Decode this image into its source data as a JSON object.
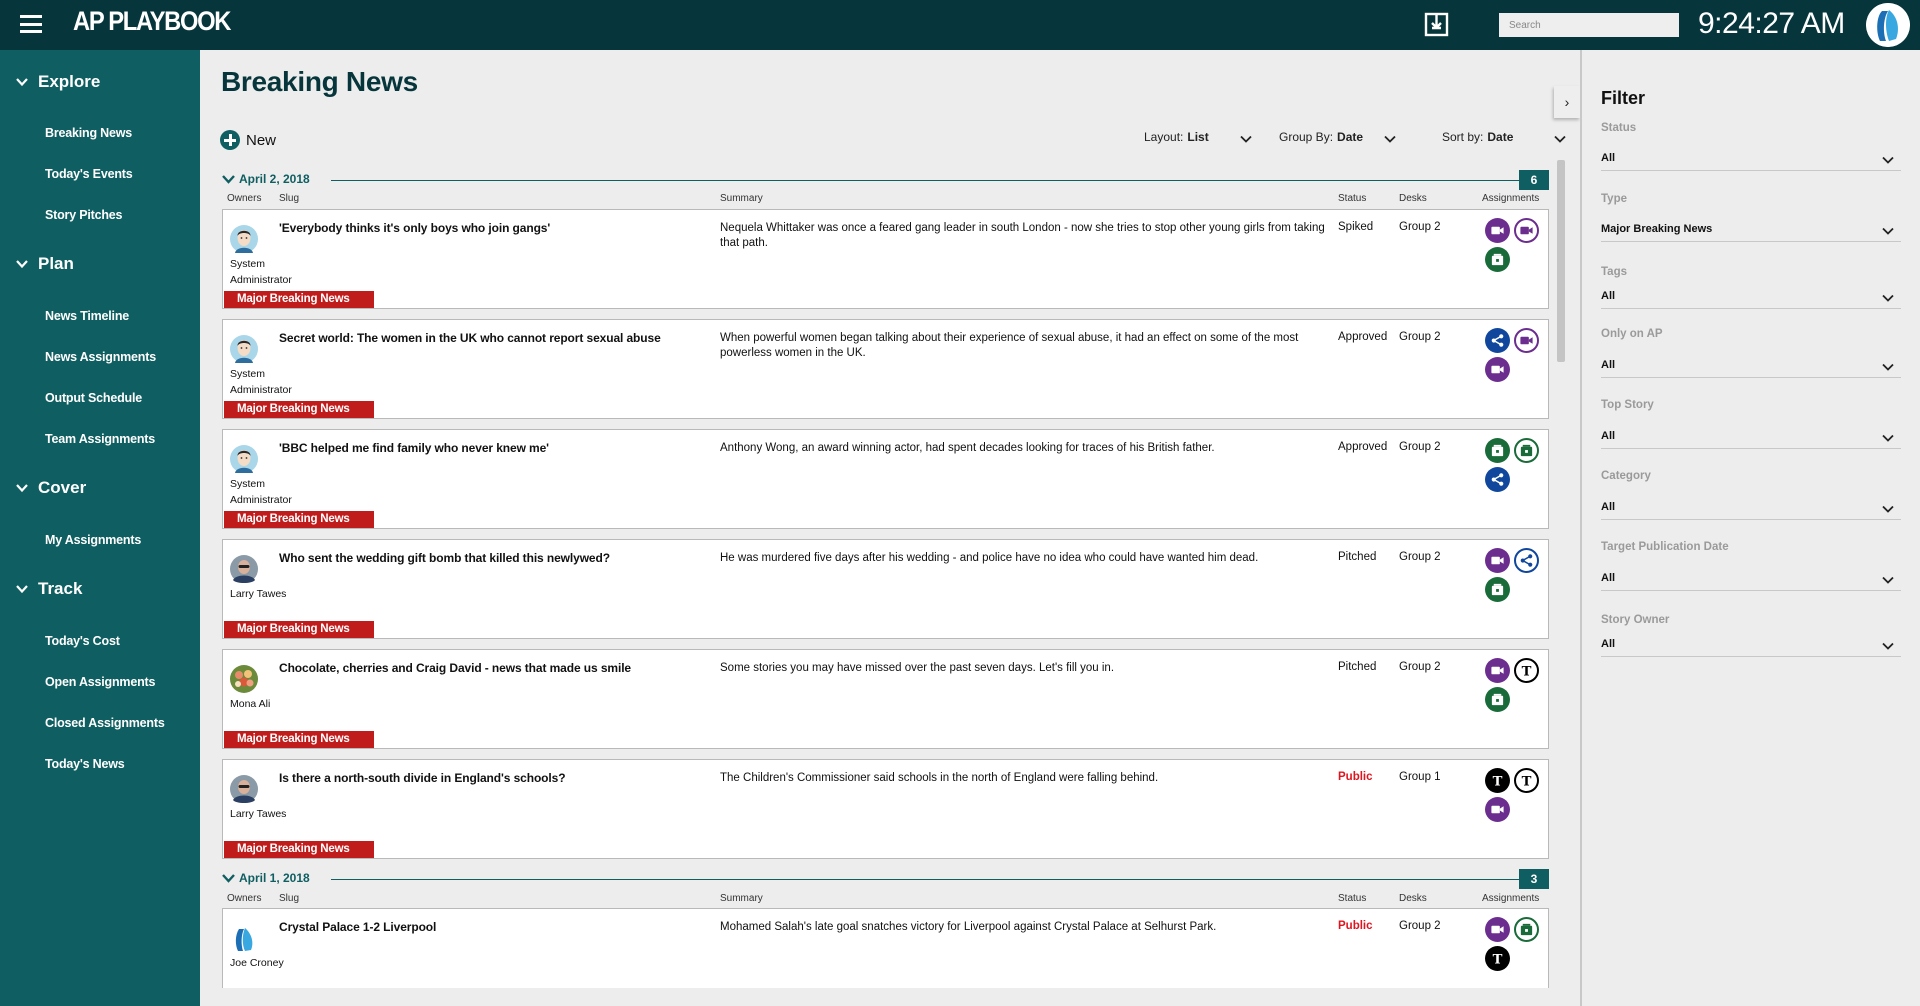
{
  "app": {
    "logo": "AP PLAYBOOK",
    "clock": "9:24:27 AM",
    "search_placeholder": "Search"
  },
  "sidebar": {
    "sections": [
      {
        "label": "Explore",
        "items": [
          "Breaking News",
          "Today's Events",
          "Story Pitches"
        ]
      },
      {
        "label": "Plan",
        "items": [
          "News Timeline",
          "News Assignments",
          "Output Schedule",
          "Team Assignments"
        ]
      },
      {
        "label": "Cover",
        "items": [
          "My Assignments"
        ]
      },
      {
        "label": "Track",
        "items": [
          "Today's Cost",
          "Open Assignments",
          "Closed Assignments",
          "Today's News"
        ]
      }
    ]
  },
  "main": {
    "title": "Breaking News",
    "new_label": "New",
    "layout": {
      "label": "Layout:",
      "value": "List"
    },
    "group_by": {
      "label": "Group By:",
      "value": "Date"
    },
    "sort_by": {
      "label": "Sort by:",
      "value": "Date"
    },
    "columns": {
      "owners": "Owners",
      "slug": "Slug",
      "summary": "Summary",
      "status": "Status",
      "desks": "Desks",
      "assignments": "Assignments"
    },
    "groups": [
      {
        "date": "April 2, 2018",
        "count": "6",
        "stories": [
          {
            "owner": "System Administrator",
            "avatar": "admin",
            "slug": "'Everybody thinks it's only boys who join gangs'",
            "summary": "Nequela Whittaker was once a feared gang leader in south London - now she tries to stop other young girls from taking that path.",
            "status": "Spiked",
            "desk": "Group 2",
            "type": "Major Breaking News",
            "assignments": [
              {
                "kind": "video",
                "style": "filled"
              },
              {
                "kind": "video",
                "style": "outline"
              },
              {
                "kind": "photo",
                "style": "filled"
              }
            ]
          },
          {
            "owner": "System Administrator",
            "avatar": "admin",
            "slug": "Secret world: The women in the UK who cannot report sexual abuse",
            "summary": "When powerful women began talking about their experience of sexual abuse, it had an effect on some of the most powerless women in the UK.",
            "status": "Approved",
            "desk": "Group 2",
            "type": "Major Breaking News",
            "assignments": [
              {
                "kind": "social",
                "style": "filled"
              },
              {
                "kind": "video",
                "style": "outline"
              },
              {
                "kind": "video",
                "style": "filled"
              }
            ]
          },
          {
            "owner": "System Administrator",
            "avatar": "admin",
            "slug": "'BBC helped me find family who never knew me'",
            "summary": "Anthony Wong, an award winning actor, had spent decades looking for traces of his British father.",
            "status": "Approved",
            "desk": "Group 2",
            "type": "Major Breaking News",
            "assignments": [
              {
                "kind": "photo",
                "style": "filled"
              },
              {
                "kind": "photo",
                "style": "outline"
              },
              {
                "kind": "social",
                "style": "filled"
              }
            ]
          },
          {
            "owner": "Larry Tawes",
            "avatar": "larry",
            "slug": "Who sent the wedding gift bomb that killed this newlywed?",
            "summary": "He was murdered five days after his wedding - and police have no idea who could have wanted him dead.",
            "status": "Pitched",
            "desk": "Group 2",
            "type": "Major Breaking News",
            "assignments": [
              {
                "kind": "video",
                "style": "filled"
              },
              {
                "kind": "social",
                "style": "outline"
              },
              {
                "kind": "photo",
                "style": "filled"
              }
            ]
          },
          {
            "owner": "Mona Ali",
            "avatar": "mona",
            "slug": "Chocolate, cherries and Craig David - news that made us smile",
            "summary": "Some stories you may have missed over the past seven days. Let's fill you in.",
            "status": "Pitched",
            "desk": "Group 2",
            "type": "Major Breaking News",
            "assignments": [
              {
                "kind": "video",
                "style": "filled"
              },
              {
                "kind": "text",
                "style": "outline"
              },
              {
                "kind": "photo",
                "style": "filled"
              }
            ]
          },
          {
            "owner": "Larry Tawes",
            "avatar": "larry",
            "slug": "Is there a north-south divide in England's schools?",
            "summary": "The Children's Commissioner said schools in the north of England were falling behind.",
            "status": "Public",
            "desk": "Group 1",
            "type": "Major Breaking News",
            "assignments": [
              {
                "kind": "text",
                "style": "filled"
              },
              {
                "kind": "text",
                "style": "outline"
              },
              {
                "kind": "video",
                "style": "filled"
              }
            ]
          }
        ]
      },
      {
        "date": "April 1, 2018",
        "count": "3",
        "stories": [
          {
            "owner": "Joe Croney",
            "avatar": "ap",
            "slug": "Crystal Palace 1-2 Liverpool",
            "summary": "Mohamed Salah's late goal snatches victory for Liverpool against Crystal Palace at Selhurst Park.",
            "status": "Public",
            "desk": "Group 2",
            "type": "",
            "assignments": [
              {
                "kind": "video",
                "style": "filled"
              },
              {
                "kind": "photo",
                "style": "outline"
              },
              {
                "kind": "text",
                "style": "filled"
              }
            ]
          }
        ]
      }
    ]
  },
  "filter": {
    "title": "Filter",
    "fields": [
      {
        "label": "Status",
        "value": "All"
      },
      {
        "label": "Type",
        "value": "Major Breaking News"
      },
      {
        "label": "Tags",
        "value": "All"
      },
      {
        "label": "Only on AP",
        "value": "All"
      },
      {
        "label": "Top Story",
        "value": "All"
      },
      {
        "label": "Category",
        "value": "All"
      },
      {
        "label": "Target Publication Date",
        "value": "All"
      },
      {
        "label": "Story Owner",
        "value": "All"
      }
    ]
  },
  "colors": {
    "topbar": "#06363b",
    "sidebar": "#0f5e61",
    "accent": "#0f5e61",
    "badge_red": "#c01c1c",
    "status_public": "#e0141f",
    "video": "#6b2e8e",
    "photo": "#1a6b3a",
    "social": "#10479c",
    "text": "#000000"
  },
  "icons": {
    "menu": "hamburger-icon",
    "download": "download-icon",
    "video": "video-camera-icon",
    "photo": "camera-icon",
    "social": "share-icon",
    "text": "text-t-icon",
    "chevron": "chevron-down-icon"
  }
}
